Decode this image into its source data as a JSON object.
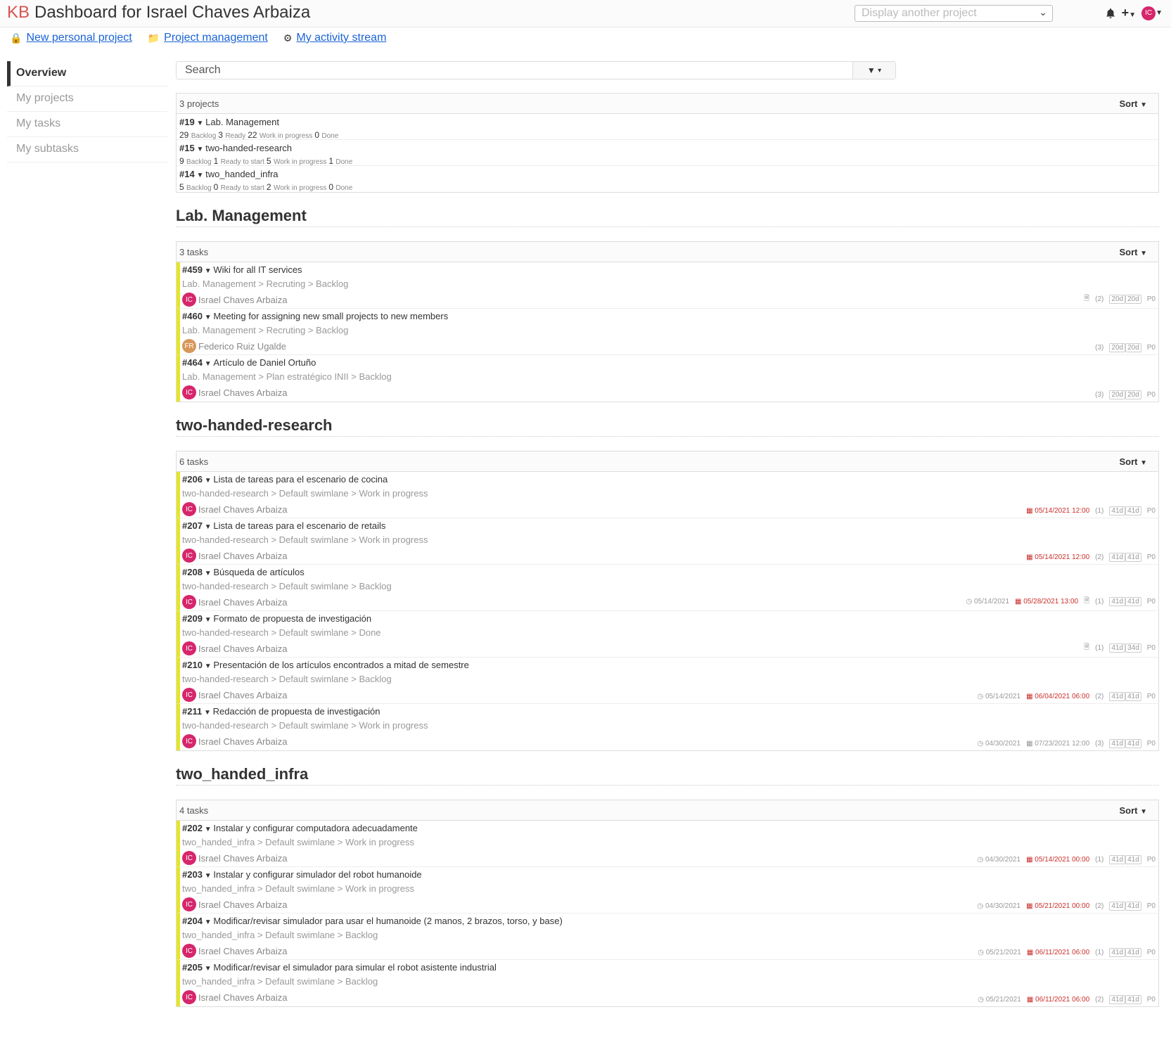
{
  "header": {
    "logo": "KB",
    "title": "Dashboard for Israel Chaves Arbaiza",
    "project_select_placeholder": "Display another project",
    "user_initials": "IC"
  },
  "subnav": {
    "new_project": "New personal project",
    "project_management": "Project management",
    "activity": "My activity stream"
  },
  "sidebar": {
    "items": [
      {
        "label": "Overview"
      },
      {
        "label": "My projects"
      },
      {
        "label": "My tasks"
      },
      {
        "label": "My subtasks"
      }
    ]
  },
  "search": {
    "placeholder": "Search"
  },
  "projects": {
    "count": "3 projects",
    "sort": "Sort",
    "rows": [
      {
        "id": "#19",
        "name": "Lab. Management",
        "cols": [
          [
            "29",
            "Backlog"
          ],
          [
            "3",
            "Ready"
          ],
          [
            "22",
            "Work in progress"
          ],
          [
            "0",
            "Done"
          ]
        ]
      },
      {
        "id": "#15",
        "name": "two-handed-research",
        "cols": [
          [
            "9",
            "Backlog"
          ],
          [
            "1",
            "Ready to start"
          ],
          [
            "5",
            "Work in progress"
          ],
          [
            "1",
            "Done"
          ]
        ]
      },
      {
        "id": "#14",
        "name": "two_handed_infra",
        "cols": [
          [
            "5",
            "Backlog"
          ],
          [
            "0",
            "Ready to start"
          ],
          [
            "2",
            "Work in progress"
          ],
          [
            "0",
            "Done"
          ]
        ]
      }
    ]
  },
  "sections": [
    {
      "title": "Lab. Management",
      "count": "3 tasks",
      "sort": "Sort",
      "tasks": [
        {
          "id": "#459",
          "title": "Wiki for all IT services",
          "path": "Lab. Management > Recruting > Backlog",
          "initials": "IC",
          "assignee": "Israel Chaves Arbaiza",
          "start": "",
          "due": "",
          "file": true,
          "comments": "(2)",
          "t1": "20d",
          "t2": "20d",
          "prio": "P0"
        },
        {
          "id": "#460",
          "title": "Meeting for assigning new small projects to new members",
          "path": "Lab. Management > Recruting > Backlog",
          "initials": "FR",
          "assignee": "Federico Ruiz Ugalde",
          "start": "",
          "due": "",
          "file": false,
          "comments": "(3)",
          "t1": "20d",
          "t2": "20d",
          "prio": "P0",
          "orange": true
        },
        {
          "id": "#464",
          "title": "Artículo de Daniel Ortuño",
          "path": "Lab. Management > Plan estratégico INII > Backlog",
          "initials": "IC",
          "assignee": "Israel Chaves Arbaiza",
          "start": "",
          "due": "",
          "file": false,
          "comments": "(3)",
          "t1": "20d",
          "t2": "20d",
          "prio": "P0"
        }
      ]
    },
    {
      "title": "two-handed-research",
      "count": "6 tasks",
      "sort": "Sort",
      "tasks": [
        {
          "id": "#206",
          "title": "Lista de tareas para el escenario de cocina",
          "path": "two-handed-research > Default swimlane > Work in progress",
          "initials": "IC",
          "assignee": "Israel Chaves Arbaiza",
          "start": "",
          "due": "05/14/2021 12:00",
          "file": false,
          "comments": "(1)",
          "t1": "41d",
          "t2": "41d",
          "prio": "P0"
        },
        {
          "id": "#207",
          "title": "Lista de tareas para el escenario de retails",
          "path": "two-handed-research > Default swimlane > Work in progress",
          "initials": "IC",
          "assignee": "Israel Chaves Arbaiza",
          "start": "",
          "due": "05/14/2021 12:00",
          "file": false,
          "comments": "(2)",
          "t1": "41d",
          "t2": "41d",
          "prio": "P0"
        },
        {
          "id": "#208",
          "title": "Búsqueda de artículos",
          "path": "two-handed-research > Default swimlane > Backlog",
          "initials": "IC",
          "assignee": "Israel Chaves Arbaiza",
          "start": "05/14/2021",
          "due": "05/28/2021 13:00",
          "file": true,
          "comments": "(1)",
          "t1": "41d",
          "t2": "41d",
          "prio": "P0"
        },
        {
          "id": "#209",
          "title": "Formato de propuesta de investigación",
          "path": "two-handed-research > Default swimlane > Done",
          "initials": "IC",
          "assignee": "Israel Chaves Arbaiza",
          "start": "",
          "due": "",
          "file": true,
          "comments": "(1)",
          "t1": "41d",
          "t2": "34d",
          "prio": "P0"
        },
        {
          "id": "#210",
          "title": "Presentación de los artículos encontrados a mitad de semestre",
          "path": "two-handed-research > Default swimlane > Backlog",
          "initials": "IC",
          "assignee": "Israel Chaves Arbaiza",
          "start": "05/14/2021",
          "due": "06/04/2021 06:00",
          "file": false,
          "comments": "(2)",
          "t1": "41d",
          "t2": "41d",
          "prio": "P0"
        },
        {
          "id": "#211",
          "title": "Redacción de propuesta de investigación",
          "path": "two-handed-research > Default swimlane > Work in progress",
          "initials": "IC",
          "assignee": "Israel Chaves Arbaiza",
          "start": "04/30/2021",
          "due": "07/23/2021 12:00",
          "file": false,
          "comments": "(3)",
          "t1": "41d",
          "t2": "41d",
          "prio": "P0",
          "due_plain": true
        }
      ]
    },
    {
      "title": "two_handed_infra",
      "count": "4 tasks",
      "sort": "Sort",
      "tasks": [
        {
          "id": "#202",
          "title": "Instalar y configurar computadora adecuadamente",
          "path": "two_handed_infra > Default swimlane > Work in progress",
          "initials": "IC",
          "assignee": "Israel Chaves Arbaiza",
          "start": "04/30/2021",
          "due": "05/14/2021 00:00",
          "file": false,
          "comments": "(1)",
          "t1": "41d",
          "t2": "41d",
          "prio": "P0"
        },
        {
          "id": "#203",
          "title": "Instalar y configurar simulador del robot humanoide",
          "path": "two_handed_infra > Default swimlane > Work in progress",
          "initials": "IC",
          "assignee": "Israel Chaves Arbaiza",
          "start": "04/30/2021",
          "due": "05/21/2021 00:00",
          "file": false,
          "comments": "(2)",
          "t1": "41d",
          "t2": "41d",
          "prio": "P0"
        },
        {
          "id": "#204",
          "title": "Modificar/revisar simulador para usar el humanoide (2 manos, 2 brazos, torso, y base)",
          "path": "two_handed_infra > Default swimlane > Backlog",
          "initials": "IC",
          "assignee": "Israel Chaves Arbaiza",
          "start": "05/21/2021",
          "due": "06/11/2021 06:00",
          "file": false,
          "comments": "(1)",
          "t1": "41d",
          "t2": "41d",
          "prio": "P0"
        },
        {
          "id": "#205",
          "title": "Modificar/revisar el simulador para simular el robot asistente industrial",
          "path": "two_handed_infra > Default swimlane > Backlog",
          "initials": "IC",
          "assignee": "Israel Chaves Arbaiza",
          "start": "05/21/2021",
          "due": "06/11/2021 06:00",
          "file": false,
          "comments": "(2)",
          "t1": "41d",
          "t2": "41d",
          "prio": "P0"
        }
      ]
    }
  ]
}
